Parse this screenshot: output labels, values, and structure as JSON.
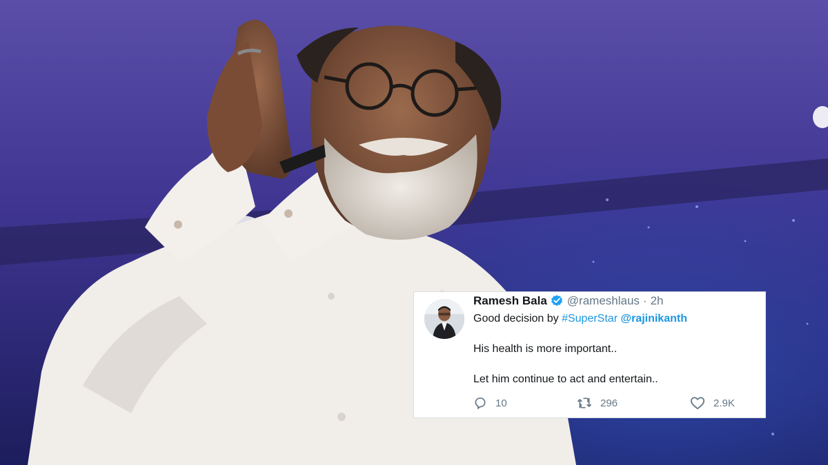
{
  "tweet": {
    "author_name": "Ramesh Bala",
    "handle": "@rameshlaus",
    "separator": "·",
    "time": "2h",
    "line1_prefix": "Good decision by ",
    "hashtag": "#SuperStar",
    "line1_space": " ",
    "mention": "@rajinikanth",
    "line2": "His health is more important..",
    "line3": "Let him continue to act and entertain..",
    "reply_count": "10",
    "retweet_count": "296",
    "like_count": "2.9K"
  },
  "icons": {
    "verified": "verified-badge-icon",
    "reply": "reply-icon",
    "retweet": "retweet-icon",
    "like": "heart-icon"
  },
  "colors": {
    "link": "#1b95e0",
    "text": "#14171a",
    "muted": "#657786",
    "verified": "#1da1f2"
  }
}
